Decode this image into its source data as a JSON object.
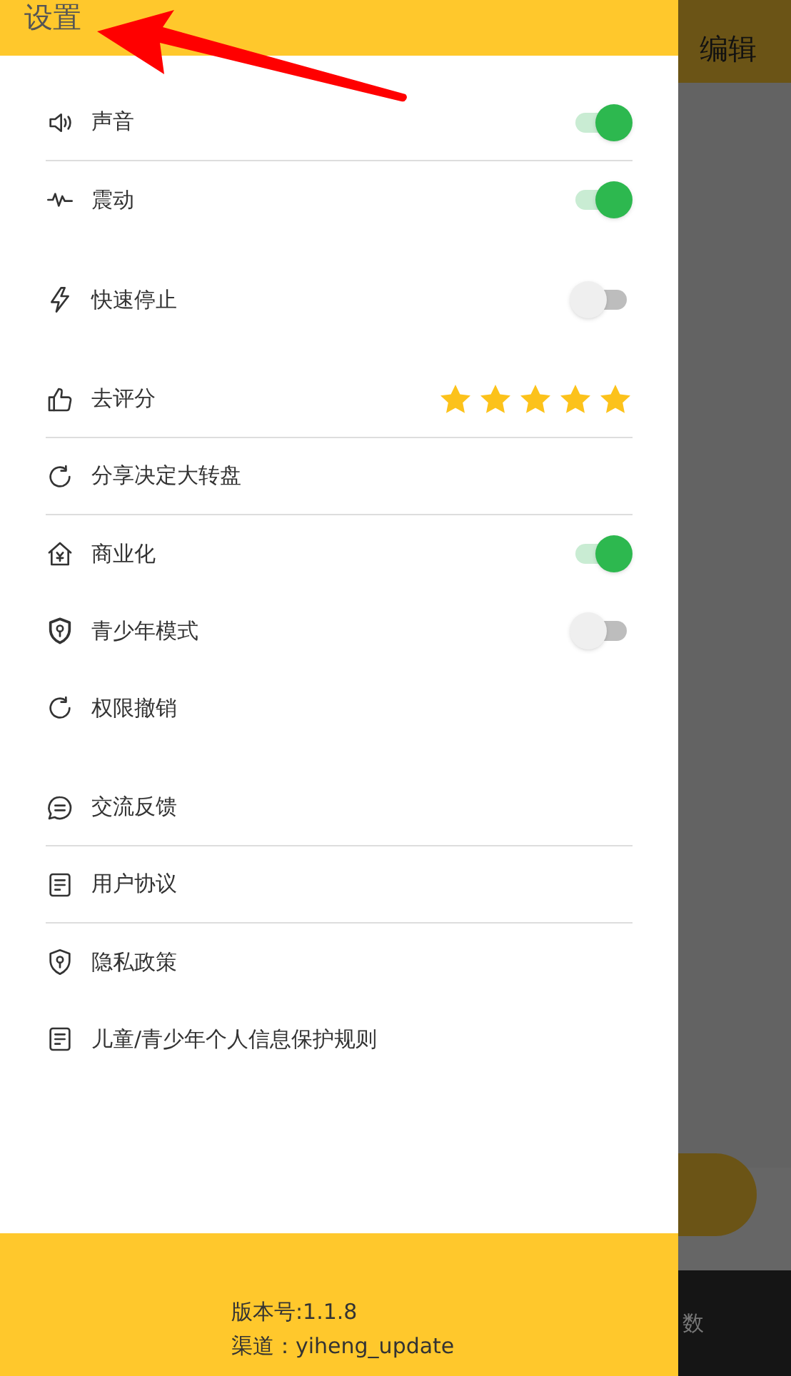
{
  "header": {
    "title": "设置"
  },
  "background": {
    "action": "编辑",
    "tab": "数"
  },
  "sections": [
    {
      "items": [
        {
          "kind": "toggle",
          "label": "声音",
          "on": true,
          "divider": true
        },
        {
          "kind": "toggle",
          "label": "震动",
          "on": true,
          "divider": false
        }
      ]
    },
    {
      "items": [
        {
          "kind": "toggle",
          "label": "快速停止",
          "on": false,
          "divider": false
        }
      ]
    },
    {
      "items": [
        {
          "kind": "rating",
          "label": "去评分",
          "stars": 5,
          "divider": true
        },
        {
          "kind": "link",
          "label": "分享决定大转盘",
          "divider": true
        },
        {
          "kind": "toggle",
          "label": "商业化",
          "on": true,
          "divider": false
        },
        {
          "kind": "toggle",
          "label": "青少年模式",
          "on": false,
          "divider": false
        },
        {
          "kind": "link",
          "label": "权限撤销",
          "divider": false
        }
      ]
    },
    {
      "items": [
        {
          "kind": "link",
          "label": "交流反馈",
          "divider": true
        },
        {
          "kind": "link",
          "label": "用户协议",
          "divider": true
        },
        {
          "kind": "link",
          "label": "隐私政策",
          "divider": false
        },
        {
          "kind": "link",
          "label": "儿童/青少年个人信息保护规则",
          "divider": false
        }
      ]
    }
  ],
  "footer": {
    "version": "版本号:1.1.8",
    "channel": "渠道：yiheng_update"
  }
}
